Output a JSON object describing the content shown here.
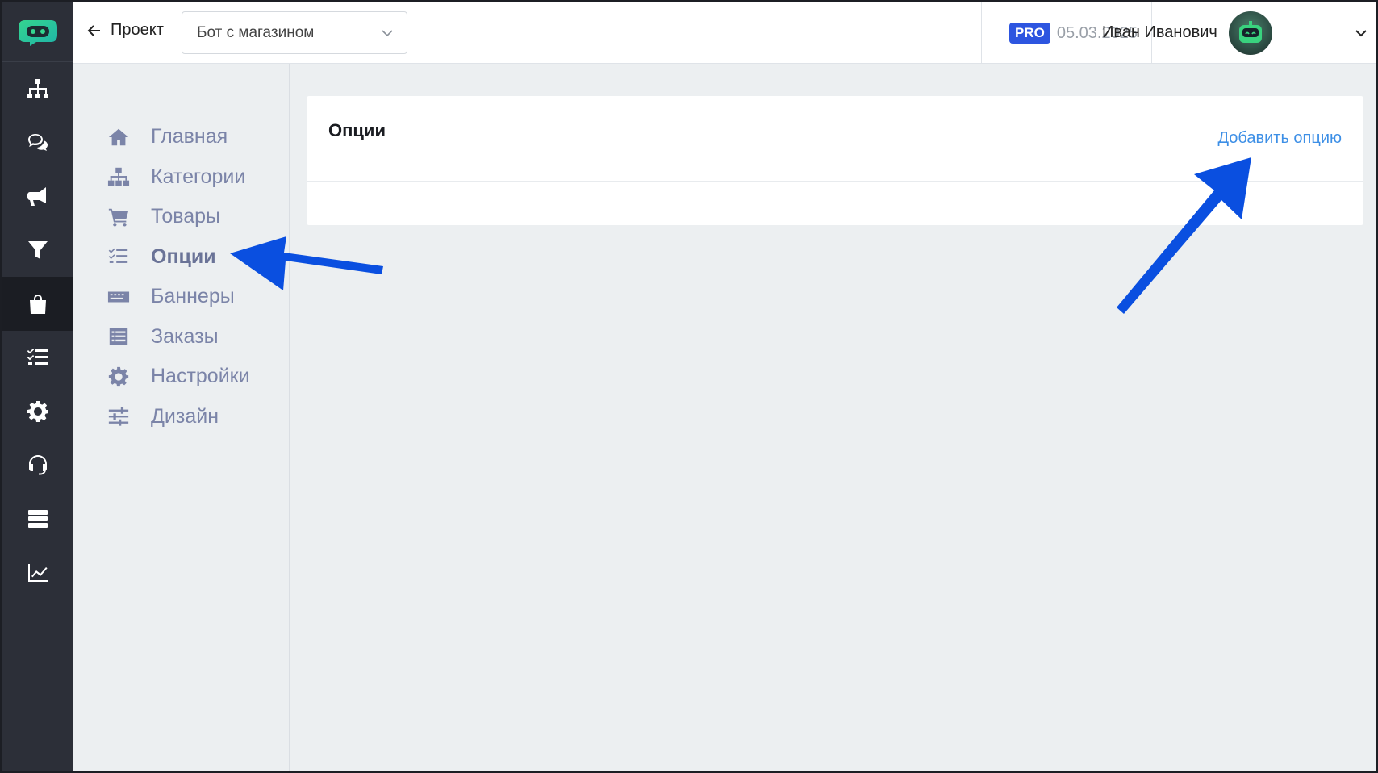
{
  "header": {
    "back_label": "Проект",
    "project_select_value": "Бот с магазином",
    "plan_badge": "PRO",
    "plan_date": "05.03.2025",
    "user_name": "Иван Иванович"
  },
  "rail": {
    "items": [
      {
        "icon": "sitemap-icon"
      },
      {
        "icon": "chat-icon"
      },
      {
        "icon": "megaphone-icon"
      },
      {
        "icon": "filter-icon"
      },
      {
        "icon": "shopping-bag-icon",
        "active": true
      },
      {
        "icon": "checklist-icon"
      },
      {
        "icon": "gear-icon"
      },
      {
        "icon": "headset-icon"
      },
      {
        "icon": "server-icon"
      },
      {
        "icon": "chart-line-icon"
      }
    ]
  },
  "subnav": {
    "items": [
      {
        "label": "Главная",
        "icon": "home-icon"
      },
      {
        "label": "Категории",
        "icon": "sitemap-icon"
      },
      {
        "label": "Товары",
        "icon": "cart-icon"
      },
      {
        "label": "Опции",
        "icon": "checklist-icon",
        "active": true
      },
      {
        "label": "Баннеры",
        "icon": "keyboard-icon"
      },
      {
        "label": "Заказы",
        "icon": "list-icon"
      },
      {
        "label": "Настройки",
        "icon": "gear-icon"
      },
      {
        "label": "Дизайн",
        "icon": "sliders-icon"
      }
    ]
  },
  "main": {
    "title": "Опции",
    "add_action": "Добавить опцию"
  },
  "colors": {
    "accent": "#3d8fe6",
    "pro_badge": "#2d55e0",
    "rail_bg": "#2c2f38",
    "annotation_arrow": "#0a4fe0"
  }
}
